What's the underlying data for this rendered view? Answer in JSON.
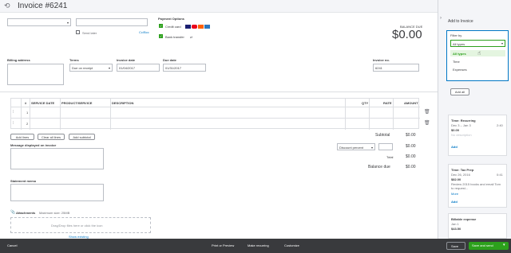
{
  "header": {
    "title": "Invoice #6241",
    "balance_due_label": "BALANCE DUE",
    "balance_due_value": "$0.00"
  },
  "customer": {
    "placeholder": "",
    "send_later_label": "Send later",
    "cc_bcc_label": "Cc/Bcc"
  },
  "payment_options": {
    "label": "Payment Options",
    "credit_card_label": "Credit card",
    "bank_transfer_label": "Bank transfer"
  },
  "form": {
    "billing_address_label": "Billing address",
    "terms_label": "Terms",
    "terms_value": "Due on receipt",
    "invoice_date_label": "Invoice date",
    "invoice_date_value": "01/04/2017",
    "due_date_label": "Due date",
    "due_date_value": "01/31/2017",
    "invoice_no_label": "Invoice no.",
    "invoice_no_value": "6241"
  },
  "table": {
    "headers": [
      "#",
      "SERVICE DATE",
      "PRODUCT/SERVICE",
      "DESCRIPTION",
      "QTY",
      "RATE",
      "AMOUNT"
    ],
    "rows": [
      "1",
      "2"
    ]
  },
  "buttons": {
    "add_lines": "Add lines",
    "clear_all_lines": "Clear all lines",
    "add_subtotal": "Add subtotal"
  },
  "totals": {
    "subtotal_label": "Subtotal",
    "subtotal_value": "$0.00",
    "discount_label": "Discount percent",
    "discount_value": "$0.00",
    "total_label": "Total",
    "total_value": "$0.00",
    "balance_due_label": "Balance due",
    "balance_due_value": "$0.00"
  },
  "memo": {
    "message_label": "Message displayed on invoice",
    "statement_label": "Statement memo",
    "attachments_label": "Attachments",
    "attachments_max": "Maximum size: 25MB",
    "drop_text": "Drag/Drop files here or click the icon",
    "show_existing": "Show existing"
  },
  "sidebar": {
    "title": "Add to Invoice",
    "filter_label": "Filter by",
    "filter_value": "All types",
    "options": [
      "All types",
      "Time",
      "Expenses"
    ],
    "add_all": "Add all",
    "cards": [
      {
        "title": "Time: Recurring",
        "date": "Dec 3 – Jan 3",
        "hours": "2:40",
        "amount": "$0.00",
        "desc": "No description",
        "action": "Add"
      },
      {
        "title": "Time: Tax Prep",
        "date": "Dec 26, 2016",
        "hours": "0:41",
        "amount": "$82.00",
        "desc": "Review 2015 books and email Tom to request...",
        "more": "More",
        "action": "Add"
      },
      {
        "title": "Billable expense",
        "date": "Jan 1",
        "amount": "$43.50"
      }
    ]
  },
  "footer": {
    "cancel": "Cancel",
    "print_preview": "Print or Preview",
    "make_recurring": "Make recurring",
    "customize": "Customize",
    "save": "Save",
    "save_and_send": "Save and send"
  }
}
